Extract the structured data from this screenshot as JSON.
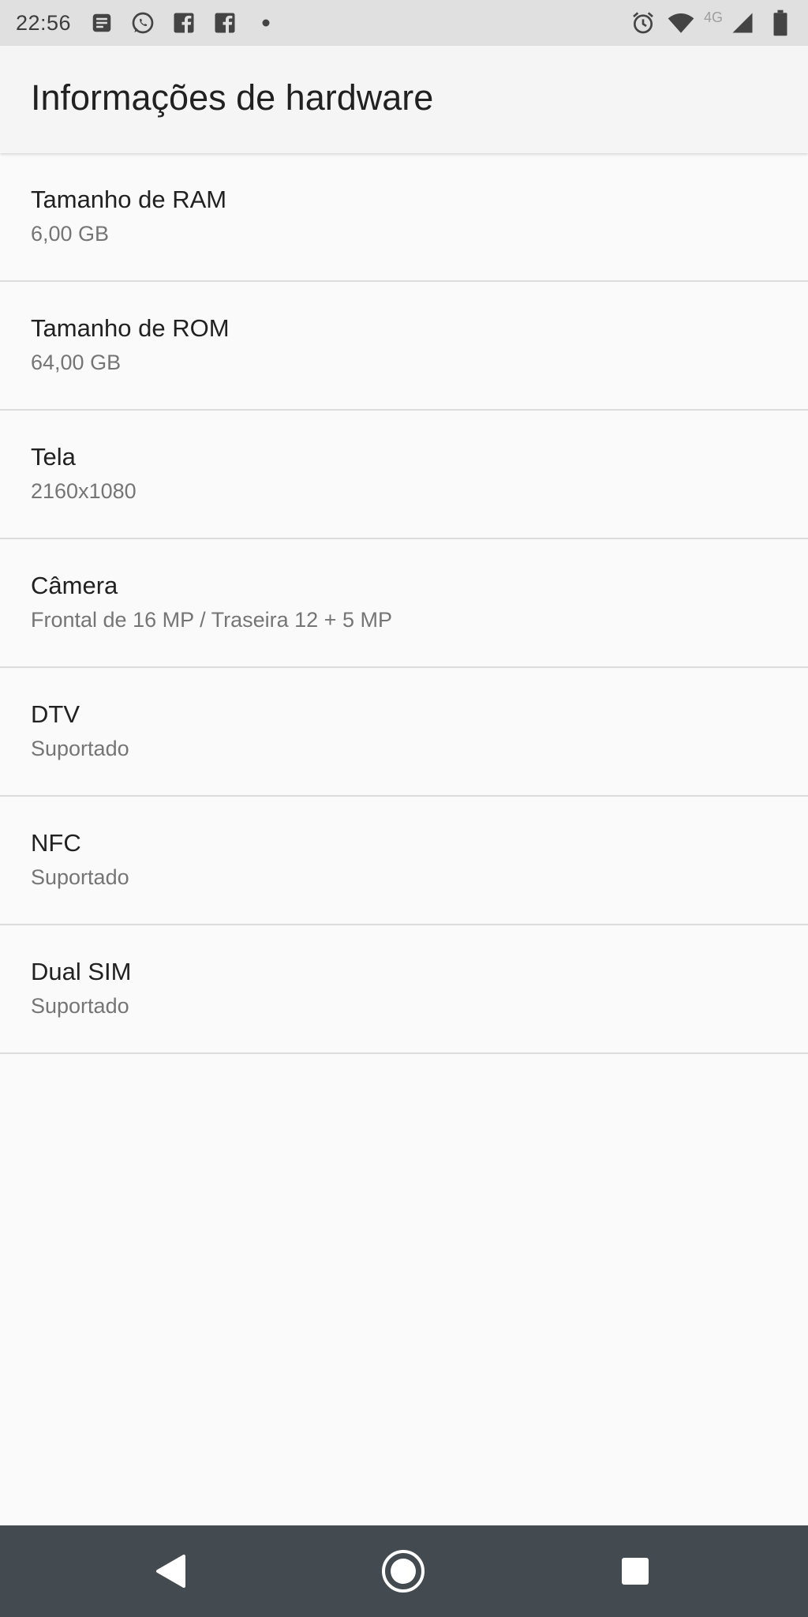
{
  "status_bar": {
    "time": "22:56",
    "left_icons": [
      "notes-icon",
      "whatsapp-icon",
      "facebook-icon",
      "facebook-icon",
      "more-notifications-dot-icon"
    ],
    "right_icons": [
      "alarm-icon",
      "wifi-icon",
      "cellular-signal-icon",
      "battery-icon"
    ],
    "network_label": "4G"
  },
  "app_bar": {
    "title": "Informações de hardware"
  },
  "hardware_list": [
    {
      "title": "Tamanho de RAM",
      "value": "6,00 GB"
    },
    {
      "title": "Tamanho de ROM",
      "value": "64,00 GB"
    },
    {
      "title": "Tela",
      "value": "2160x1080"
    },
    {
      "title": "Câmera",
      "value": "Frontal de 16 MP / Traseira 12 + 5 MP"
    },
    {
      "title": "DTV",
      "value": "Suportado"
    },
    {
      "title": "NFC",
      "value": "Suportado"
    },
    {
      "title": "Dual SIM",
      "value": "Suportado"
    }
  ],
  "nav_bar": {
    "buttons": [
      "back-icon",
      "home-icon",
      "recent-apps-icon"
    ]
  },
  "colors": {
    "status_bar_bg": "#e0e0e0",
    "app_bar_bg": "#f5f5f5",
    "background": "#fafafa",
    "primary_text": "#212121",
    "secondary_text": "#757575",
    "divider": "#dcdcdc",
    "nav_bar_bg": "#434a50"
  }
}
